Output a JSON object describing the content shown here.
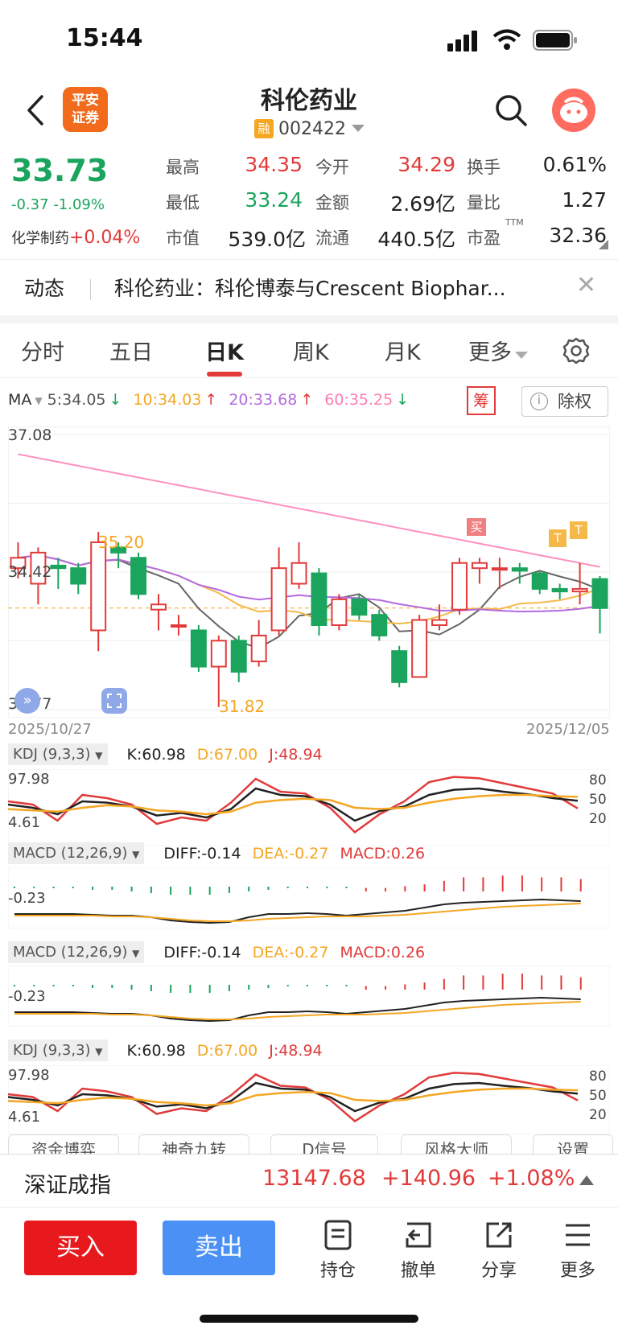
{
  "status_bar": {
    "time": "15:44"
  },
  "header": {
    "broker_logo": "平安\n证券",
    "title": "科伦药业",
    "margin_badge": "融",
    "code": "002422"
  },
  "quote": {
    "price": "33.73",
    "change": "-0.37",
    "change_pct": "-1.09%",
    "industry_label": "化学制药",
    "industry_pct": "+0.04%",
    "fields": [
      {
        "label": "最高",
        "value": "34.35",
        "color": "red"
      },
      {
        "label": "今开",
        "value": "34.29",
        "color": "red"
      },
      {
        "label": "换手",
        "value": "0.61%",
        "color": "dark"
      },
      {
        "label": "最低",
        "value": "33.24",
        "color": "green"
      },
      {
        "label": "金额",
        "value": "2.69亿",
        "color": "dark"
      },
      {
        "label": "量比",
        "value": "1.27",
        "color": "dark"
      },
      {
        "label": "市值",
        "value": "539.0亿",
        "color": "dark"
      },
      {
        "label": "流通",
        "value": "440.5亿",
        "color": "dark"
      },
      {
        "label": "市盈",
        "value": "32.36",
        "color": "dark",
        "sup": "TTM"
      }
    ]
  },
  "news": {
    "tag": "动态",
    "text": "科伦药业：科伦博泰与Crescent Biophar..."
  },
  "tabs": [
    "分时",
    "五日",
    "日K",
    "周K",
    "月K",
    "更多"
  ],
  "active_tab": "日K",
  "ma_legend": {
    "label": "MA",
    "ma5": "5:34.05",
    "ma10": "10:34.03",
    "ma20": "20:33.68",
    "ma60": "60:35.25"
  },
  "chart_buttons": {
    "chou": "筹",
    "chuquan": "除权",
    "info_icon": "i"
  },
  "chart_data": {
    "type": "candlestick",
    "date_start": "2025/10/27",
    "date_end": "2025/12/05",
    "y_labels": [
      "37.08",
      "34.42",
      "31.77"
    ],
    "annotations": {
      "high_mark": "35.20",
      "low_mark": "31.82",
      "buy_signal": "买",
      "t_signal": "T"
    },
    "candles": [
      {
        "o": 34.5,
        "c": 34.7,
        "h": 35.0,
        "l": 34.3
      },
      {
        "o": 34.2,
        "c": 34.8,
        "h": 34.9,
        "l": 33.8
      },
      {
        "o": 34.55,
        "c": 34.5,
        "h": 34.7,
        "l": 34.1
      },
      {
        "o": 34.5,
        "c": 34.2,
        "h": 34.6,
        "l": 34.0
      },
      {
        "o": 33.3,
        "c": 35.0,
        "h": 35.2,
        "l": 32.9
      },
      {
        "o": 34.9,
        "c": 34.8,
        "h": 35.0,
        "l": 34.5
      },
      {
        "o": 34.7,
        "c": 34.0,
        "h": 34.8,
        "l": 33.9
      },
      {
        "o": 33.7,
        "c": 33.8,
        "h": 34.0,
        "l": 33.3
      },
      {
        "o": 33.4,
        "c": 33.4,
        "h": 33.6,
        "l": 33.2
      },
      {
        "o": 33.3,
        "c": 32.6,
        "h": 33.4,
        "l": 32.5
      },
      {
        "o": 32.6,
        "c": 33.1,
        "h": 33.2,
        "l": 31.82
      },
      {
        "o": 33.1,
        "c": 32.5,
        "h": 33.2,
        "l": 32.3
      },
      {
        "o": 32.7,
        "c": 33.2,
        "h": 33.5,
        "l": 32.6
      },
      {
        "o": 33.3,
        "c": 34.5,
        "h": 34.9,
        "l": 33.2
      },
      {
        "o": 34.2,
        "c": 34.6,
        "h": 35.0,
        "l": 34.1
      },
      {
        "o": 34.4,
        "c": 33.4,
        "h": 34.5,
        "l": 33.2
      },
      {
        "o": 33.4,
        "c": 33.9,
        "h": 34.0,
        "l": 33.3
      },
      {
        "o": 33.9,
        "c": 33.6,
        "h": 34.0,
        "l": 33.5
      },
      {
        "o": 33.6,
        "c": 33.2,
        "h": 33.7,
        "l": 33.1
      },
      {
        "o": 32.9,
        "c": 32.3,
        "h": 33.0,
        "l": 32.2
      },
      {
        "o": 32.4,
        "c": 33.5,
        "h": 33.6,
        "l": 32.4
      },
      {
        "o": 33.4,
        "c": 33.5,
        "h": 33.8,
        "l": 33.3
      },
      {
        "o": 33.7,
        "c": 34.6,
        "h": 34.7,
        "l": 33.6
      },
      {
        "o": 34.5,
        "c": 34.6,
        "h": 34.7,
        "l": 34.2
      },
      {
        "o": 34.5,
        "c": 34.5,
        "h": 34.7,
        "l": 34.1
      },
      {
        "o": 34.5,
        "c": 34.45,
        "h": 34.6,
        "l": 34.2
      },
      {
        "o": 34.4,
        "c": 34.1,
        "h": 34.45,
        "l": 34.0
      },
      {
        "o": 34.1,
        "c": 34.05,
        "h": 34.2,
        "l": 33.9
      },
      {
        "o": 34.05,
        "c": 34.1,
        "h": 34.6,
        "l": 33.8
      },
      {
        "o": 34.29,
        "c": 33.73,
        "h": 34.35,
        "l": 33.24
      }
    ]
  },
  "kdj": {
    "head": "KDJ (9,3,3)",
    "k": "K:60.98",
    "d": "D:67.00",
    "j": "J:48.94",
    "top": "97.98",
    "bottom": "4.61",
    "levels": [
      "80",
      "50",
      "20"
    ]
  },
  "macd": {
    "head": "MACD (12,26,9)",
    "diff": "DIFF:-0.14",
    "dea": "DEA:-0.27",
    "macd": "MACD:0.26",
    "level": "-0.23"
  },
  "tool_buttons": [
    "资金博弈",
    "神奇九转",
    "D信号",
    "风格大师",
    "设置"
  ],
  "index": {
    "name": "深证成指",
    "value": "13147.68",
    "change": "+140.96",
    "pct": "+1.08%"
  },
  "bottom_nav": {
    "buy": "买入",
    "sell": "卖出",
    "items": [
      {
        "label": "持仓"
      },
      {
        "label": "撤单"
      },
      {
        "label": "分享"
      },
      {
        "label": "更多"
      }
    ]
  }
}
